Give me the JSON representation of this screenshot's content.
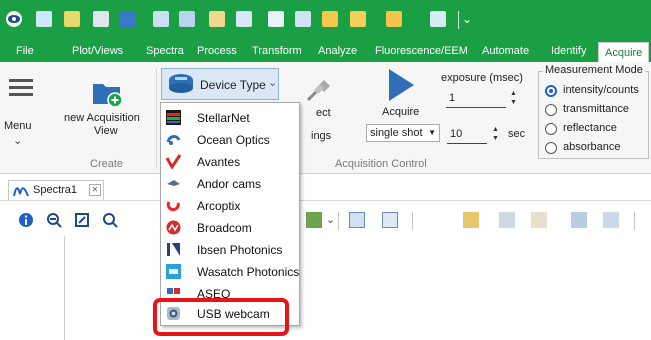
{
  "menu_tabs": [
    {
      "label": "File"
    },
    {
      "label": "Plot/Views"
    },
    {
      "label": "Spectra"
    },
    {
      "label": "Process"
    },
    {
      "label": "Transform"
    },
    {
      "label": "Analyze"
    },
    {
      "label": "Fluorescence/EEM"
    },
    {
      "label": "Automate"
    },
    {
      "label": "Identify"
    },
    {
      "label": "Acquire"
    }
  ],
  "active_tab": "Acquire",
  "quick_access": {
    "overflow_glyph": "⌄"
  },
  "ribbon": {
    "menu_label": "Menu",
    "menu_chevron": "⌄",
    "new_acquisition_line1": "new Acquisition",
    "new_acquisition_line2": "View",
    "create_group_label": "Create",
    "device_type_label": "Device Type",
    "device_type_chevron": "⌄",
    "connect_partial": "ect",
    "settings_partial": "ings",
    "acquire_label": "Acquire",
    "acquisition_control_partial": "Acquisition Control",
    "exposure_label": "exposure (msec)",
    "exposure_value": "1",
    "mode_value": "single shot",
    "average_value": "10",
    "sec_label": "sec",
    "measurement_mode": {
      "title": "Measurement Mode",
      "options": [
        {
          "label": "intensity/counts",
          "selected": true
        },
        {
          "label": "transmittance",
          "selected": false
        },
        {
          "label": "reflectance",
          "selected": false
        },
        {
          "label": "absorbance",
          "selected": false
        }
      ]
    }
  },
  "document_tab": {
    "label": "Spectra1",
    "close_glyph": "✕"
  },
  "toolbar": {
    "chevron": "⌄"
  },
  "device_dropdown": {
    "items": [
      {
        "label": "StellarNet",
        "icon": "stellarnet-icon"
      },
      {
        "label": "Ocean Optics",
        "icon": "ocean-optics-icon"
      },
      {
        "label": "Avantes",
        "icon": "avantes-icon"
      },
      {
        "label": "Andor cams",
        "icon": "andor-icon"
      },
      {
        "label": "Arcoptix",
        "icon": "arcoptix-icon"
      },
      {
        "label": "Broadcom",
        "icon": "broadcom-icon"
      },
      {
        "label": "Ibsen Photonics",
        "icon": "ibsen-icon"
      },
      {
        "label": "Wasatch Photonics",
        "icon": "wasatch-icon"
      },
      {
        "label": "ASEQ",
        "icon": "aseq-icon"
      },
      {
        "label": "USB webcam",
        "icon": "webcam-icon"
      }
    ]
  },
  "colors": {
    "ribbon_green": "#1b9f45",
    "highlight_red": "#e8141a",
    "accent_blue": "#1f5fc8"
  }
}
